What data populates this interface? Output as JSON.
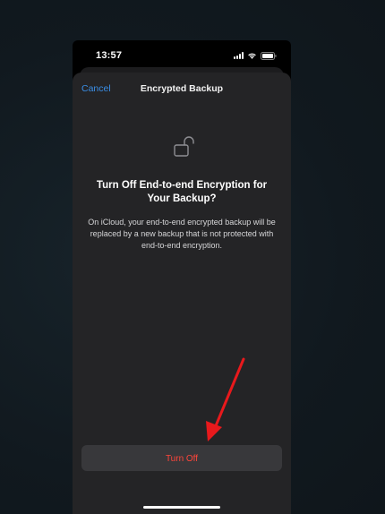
{
  "status_bar": {
    "time": "13:57"
  },
  "nav": {
    "cancel_label": "Cancel",
    "title": "Encrypted Backup"
  },
  "content": {
    "icon": "unlocked-padlock-icon",
    "headline": "Turn Off End-to-end Encryption for Your Backup?",
    "body": "On iCloud, your end-to-end encrypted backup will be replaced by a new backup that is not protected with end-to-end encryption."
  },
  "actions": {
    "turn_off_label": "Turn Off"
  },
  "colors": {
    "accent_blue": "#3a8ee6",
    "destructive_red": "#ff453a",
    "annotation_arrow": "#e8191c",
    "sheet_background": "#242426",
    "button_background": "#38383b"
  }
}
